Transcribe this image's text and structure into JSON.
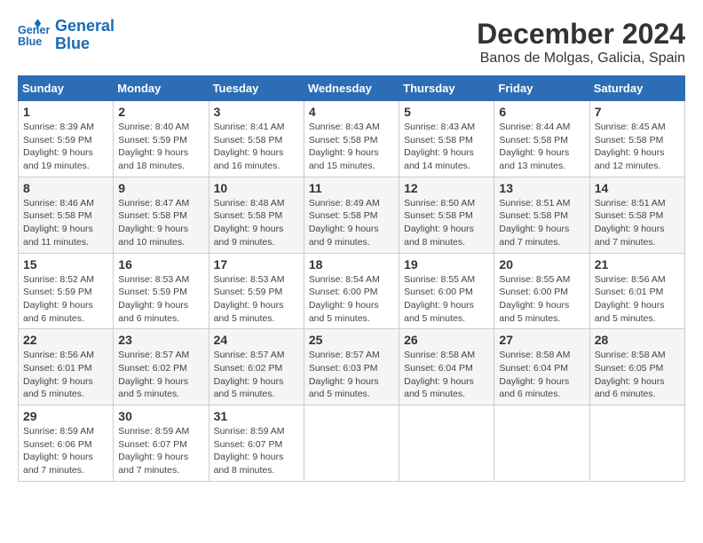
{
  "header": {
    "logo_line1": "General",
    "logo_line2": "Blue",
    "month_title": "December 2024",
    "location": "Banos de Molgas, Galicia, Spain"
  },
  "days_of_week": [
    "Sunday",
    "Monday",
    "Tuesday",
    "Wednesday",
    "Thursday",
    "Friday",
    "Saturday"
  ],
  "weeks": [
    [
      {
        "day": "1",
        "sunrise": "8:39 AM",
        "sunset": "5:59 PM",
        "daylight": "9 hours and 19 minutes."
      },
      {
        "day": "2",
        "sunrise": "8:40 AM",
        "sunset": "5:59 PM",
        "daylight": "9 hours and 18 minutes."
      },
      {
        "day": "3",
        "sunrise": "8:41 AM",
        "sunset": "5:58 PM",
        "daylight": "9 hours and 16 minutes."
      },
      {
        "day": "4",
        "sunrise": "8:43 AM",
        "sunset": "5:58 PM",
        "daylight": "9 hours and 15 minutes."
      },
      {
        "day": "5",
        "sunrise": "8:43 AM",
        "sunset": "5:58 PM",
        "daylight": "9 hours and 14 minutes."
      },
      {
        "day": "6",
        "sunrise": "8:44 AM",
        "sunset": "5:58 PM",
        "daylight": "9 hours and 13 minutes."
      },
      {
        "day": "7",
        "sunrise": "8:45 AM",
        "sunset": "5:58 PM",
        "daylight": "9 hours and 12 minutes."
      }
    ],
    [
      {
        "day": "8",
        "sunrise": "8:46 AM",
        "sunset": "5:58 PM",
        "daylight": "9 hours and 11 minutes."
      },
      {
        "day": "9",
        "sunrise": "8:47 AM",
        "sunset": "5:58 PM",
        "daylight": "9 hours and 10 minutes."
      },
      {
        "day": "10",
        "sunrise": "8:48 AM",
        "sunset": "5:58 PM",
        "daylight": "9 hours and 9 minutes."
      },
      {
        "day": "11",
        "sunrise": "8:49 AM",
        "sunset": "5:58 PM",
        "daylight": "9 hours and 9 minutes."
      },
      {
        "day": "12",
        "sunrise": "8:50 AM",
        "sunset": "5:58 PM",
        "daylight": "9 hours and 8 minutes."
      },
      {
        "day": "13",
        "sunrise": "8:51 AM",
        "sunset": "5:58 PM",
        "daylight": "9 hours and 7 minutes."
      },
      {
        "day": "14",
        "sunrise": "8:51 AM",
        "sunset": "5:58 PM",
        "daylight": "9 hours and 7 minutes."
      }
    ],
    [
      {
        "day": "15",
        "sunrise": "8:52 AM",
        "sunset": "5:59 PM",
        "daylight": "9 hours and 6 minutes."
      },
      {
        "day": "16",
        "sunrise": "8:53 AM",
        "sunset": "5:59 PM",
        "daylight": "9 hours and 6 minutes."
      },
      {
        "day": "17",
        "sunrise": "8:53 AM",
        "sunset": "5:59 PM",
        "daylight": "9 hours and 5 minutes."
      },
      {
        "day": "18",
        "sunrise": "8:54 AM",
        "sunset": "6:00 PM",
        "daylight": "9 hours and 5 minutes."
      },
      {
        "day": "19",
        "sunrise": "8:55 AM",
        "sunset": "6:00 PM",
        "daylight": "9 hours and 5 minutes."
      },
      {
        "day": "20",
        "sunrise": "8:55 AM",
        "sunset": "6:00 PM",
        "daylight": "9 hours and 5 minutes."
      },
      {
        "day": "21",
        "sunrise": "8:56 AM",
        "sunset": "6:01 PM",
        "daylight": "9 hours and 5 minutes."
      }
    ],
    [
      {
        "day": "22",
        "sunrise": "8:56 AM",
        "sunset": "6:01 PM",
        "daylight": "9 hours and 5 minutes."
      },
      {
        "day": "23",
        "sunrise": "8:57 AM",
        "sunset": "6:02 PM",
        "daylight": "9 hours and 5 minutes."
      },
      {
        "day": "24",
        "sunrise": "8:57 AM",
        "sunset": "6:02 PM",
        "daylight": "9 hours and 5 minutes."
      },
      {
        "day": "25",
        "sunrise": "8:57 AM",
        "sunset": "6:03 PM",
        "daylight": "9 hours and 5 minutes."
      },
      {
        "day": "26",
        "sunrise": "8:58 AM",
        "sunset": "6:04 PM",
        "daylight": "9 hours and 5 minutes."
      },
      {
        "day": "27",
        "sunrise": "8:58 AM",
        "sunset": "6:04 PM",
        "daylight": "9 hours and 6 minutes."
      },
      {
        "day": "28",
        "sunrise": "8:58 AM",
        "sunset": "6:05 PM",
        "daylight": "9 hours and 6 minutes."
      }
    ],
    [
      {
        "day": "29",
        "sunrise": "8:59 AM",
        "sunset": "6:06 PM",
        "daylight": "9 hours and 7 minutes."
      },
      {
        "day": "30",
        "sunrise": "8:59 AM",
        "sunset": "6:07 PM",
        "daylight": "9 hours and 7 minutes."
      },
      {
        "day": "31",
        "sunrise": "8:59 AM",
        "sunset": "6:07 PM",
        "daylight": "9 hours and 8 minutes."
      },
      null,
      null,
      null,
      null
    ]
  ]
}
